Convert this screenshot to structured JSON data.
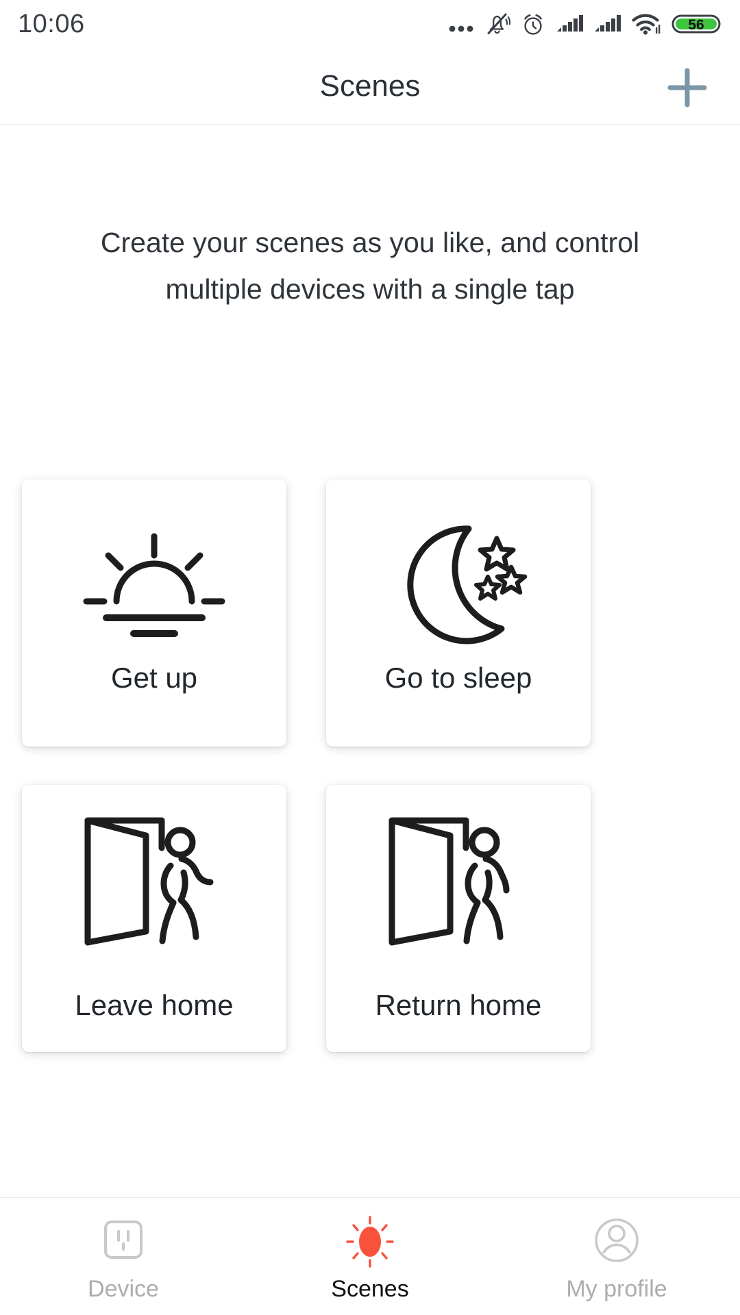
{
  "status_bar": {
    "time": "10:06",
    "icons": [
      {
        "name": "more-dots-icon"
      },
      {
        "name": "notifications-muted-icon"
      },
      {
        "name": "alarm-clock-icon"
      },
      {
        "name": "signal-bars-1-icon"
      },
      {
        "name": "signal-bars-2-icon"
      },
      {
        "name": "wifi-icon"
      },
      {
        "name": "battery-icon"
      }
    ],
    "battery_level": "56",
    "battery_color": "#3ec43e"
  },
  "header": {
    "title": "Scenes",
    "add_icon": "plus-icon",
    "add_icon_color": "#7b96a6"
  },
  "main": {
    "subtitle_line1": "Create your scenes as you like, and control",
    "subtitle_line2": "multiple devices with a single tap",
    "scenes": [
      {
        "label": "Get up",
        "icon": "sunrise-icon"
      },
      {
        "label": "Go to sleep",
        "icon": "moon-stars-icon"
      },
      {
        "label": "Leave home",
        "icon": "door-person-leaving-icon"
      },
      {
        "label": "Return home",
        "icon": "door-person-entering-icon"
      }
    ]
  },
  "bottom_nav": {
    "active_color": "#121212",
    "inactive_color": "#adadad",
    "accent_color": "#f8523c",
    "items": [
      {
        "label": "Device",
        "icon": "power-outlet-icon",
        "active": false
      },
      {
        "label": "Scenes",
        "icon": "sun-icon",
        "active": true
      },
      {
        "label": "My profile",
        "icon": "user-circle-icon",
        "active": false
      }
    ]
  }
}
